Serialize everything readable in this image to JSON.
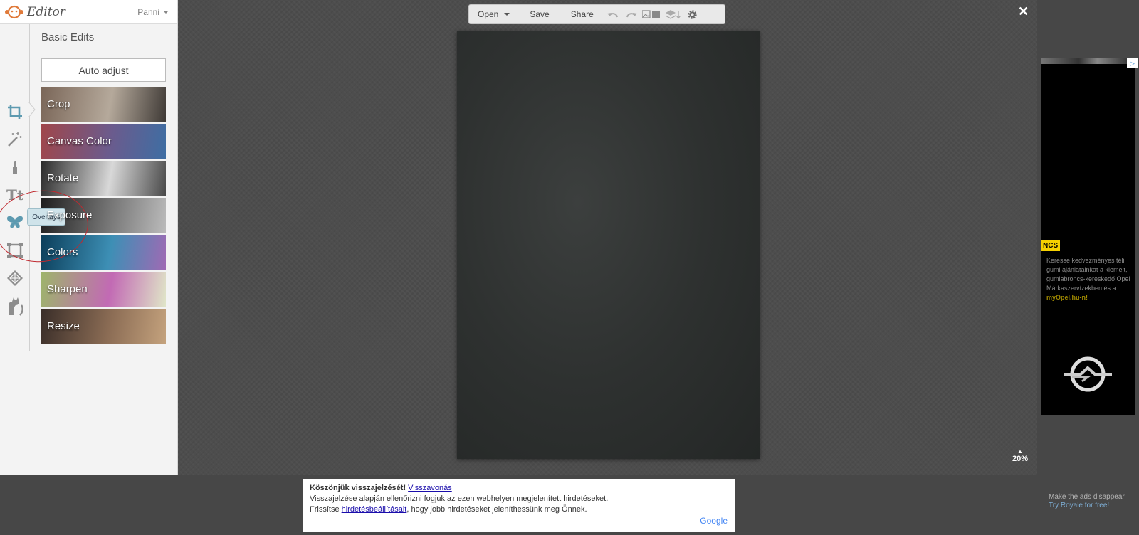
{
  "header": {
    "app_name": "Editor",
    "user_name": "Panni"
  },
  "panel": {
    "title": "Basic Edits",
    "auto_adjust": "Auto adjust",
    "edits": [
      {
        "label": "Crop",
        "colors": [
          "#7a6658",
          "#b5a99b",
          "#3f3a36"
        ]
      },
      {
        "label": "Canvas Color",
        "colors": [
          "#a0464a",
          "#6b5b8d",
          "#3e6ea3"
        ]
      },
      {
        "label": "Rotate",
        "colors": [
          "#2b2b2b",
          "#d8d8d8",
          "#4a4a4a"
        ]
      },
      {
        "label": "Exposure",
        "colors": [
          "#1e1e1e",
          "#777",
          "#bbb"
        ]
      },
      {
        "label": "Colors",
        "colors": [
          "#0b3e5a",
          "#3d8fb5",
          "#9f6ab4"
        ]
      },
      {
        "label": "Sharpen",
        "colors": [
          "#9db46b",
          "#c26ab4",
          "#e0e6c8"
        ]
      },
      {
        "label": "Resize",
        "colors": [
          "#3a2e29",
          "#8c6d55",
          "#c4a27d"
        ]
      }
    ],
    "tooltip": "Overlays"
  },
  "toolbar": {
    "open": "Open",
    "save": "Save",
    "share": "Share"
  },
  "workspace": {
    "zoom": "20%",
    "close": "✕"
  },
  "ad": {
    "badge": "NCS",
    "body_prefix": "Keresse kedvezményes téli gumi ajánlatainkat a kiemelt, gumiabroncs-kereskedő Opel Márkaszervízekben és a ",
    "body_brand": "myOpel.hu-n!",
    "info": "▷"
  },
  "royale": {
    "line1": "Make the ads disappear.",
    "link": "Try Royale for free!"
  },
  "feedback": {
    "title": "Köszönjük visszajelzését!",
    "undo": "Visszavonás",
    "line2": "Visszajelzése alapján ellenőrizni fogjuk az ezen webhelyen megjelenített hirdetéseket.",
    "line3_pre": "Frissítse ",
    "line3_link": "hirdetésbeállításait",
    "line3_post": ", hogy jobb hirdetéseket jeleníthessünk meg Önnek.",
    "google": "Google"
  },
  "colors": {
    "accent_icon": "#5d9ab0",
    "icon_gray": "#8d8d8d"
  }
}
